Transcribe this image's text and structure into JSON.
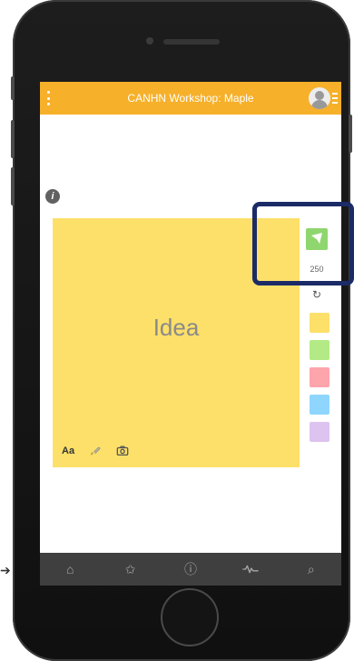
{
  "app": {
    "title": "CANHN Workshop: Maple"
  },
  "note": {
    "text": "Idea",
    "font_toggle_label": "Aa"
  },
  "composer": {
    "count": "250"
  },
  "colors": {
    "topbar": "#f6b02a",
    "note": "#fde06a",
    "send_button": "#8fd66e",
    "swatches": [
      "#fde06a",
      "#b3ea86",
      "#fda5aa",
      "#8fd6ff",
      "#ddc3ef"
    ],
    "highlight": "#1b2b68"
  },
  "icons": {
    "menu": "menu-icon",
    "profile": "profile-icon",
    "info": "info-icon",
    "brush": "brush-icon",
    "camera": "camera-icon",
    "send": "send-icon",
    "refresh": "refresh-icon",
    "home": "home-icon",
    "star": "star-icon",
    "help": "help-icon",
    "activity": "activity-icon",
    "search": "search-icon"
  }
}
